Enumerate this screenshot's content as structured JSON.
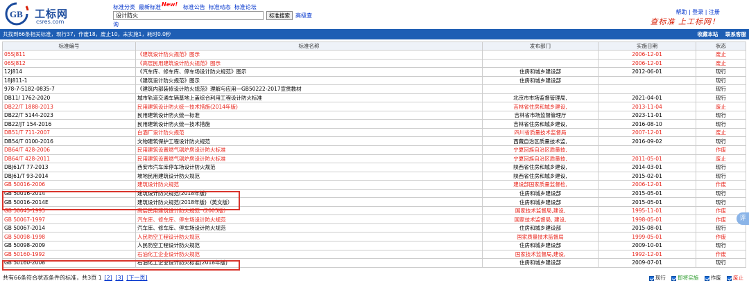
{
  "header": {
    "logo_title": "工标网",
    "logo_sub": "csres.com",
    "logo_mark": "GB",
    "nav": [
      "标准分类",
      "最新标准",
      "标准公告",
      "标准动态",
      "标准论坛"
    ],
    "nav_new_badge": "New!",
    "search_value": "设计防火",
    "search_button": "标准搜索",
    "advanced": "高级查",
    "advanced_tail": "询",
    "top_links": "帮助 | 登录 | 注册",
    "slogan": "查标准 上工标网！"
  },
  "infobar": {
    "summary": "共找到66条相关标准，现行37，作废18，废止10，未实施1，耗时0.0秒",
    "bookmark": "收藏本站",
    "contact": "联系客服"
  },
  "table": {
    "headers": [
      "标准编号",
      "标准名称",
      "发布部门",
      "实施日期",
      "状态"
    ],
    "rows": [
      {
        "code": "05SJ811",
        "name": "《建筑设计防火规范》图示",
        "dept": "",
        "date": "2006-12-01",
        "status": "废止",
        "red": true
      },
      {
        "code": "06SJ812",
        "name": "《高层民用建筑设计防火规范》图示",
        "dept": "",
        "date": "2006-12-01",
        "status": "废止",
        "red": true
      },
      {
        "code": "12J814",
        "name": "《汽车库、修车库、停车场设计防火规范》图示",
        "dept": "住房和城乡建设部",
        "date": "2012-06-01",
        "status": "现行",
        "red": false
      },
      {
        "code": "18J811-1",
        "name": "《建筑设计防火规范》图示",
        "dept": "住房和城乡建设部",
        "date": "",
        "status": "现行",
        "red": false
      },
      {
        "code": "978-7-5182-0835-7",
        "name": "《建筑内部装修设计防火规范》理解与应用—GB50222-2017宣贯教材",
        "dept": "",
        "date": "",
        "status": "现行",
        "red": false
      },
      {
        "code": "DB11/ 1762-2020",
        "name": "城市轨道交通车辆基地上盖综合利用工程设计防火标准",
        "dept": "北京市市场监督管理局,",
        "date": "2021-04-01",
        "status": "现行",
        "red": false
      },
      {
        "code": "DB22/T 1888-2013",
        "name": "民用建筑设计防火统一技术措施(2014年版)",
        "dept": "吉林省住房和城乡建设,",
        "date": "2013-11-04",
        "status": "废止",
        "red": true
      },
      {
        "code": "DB22/T 5144-2023",
        "name": "民用建筑设计防火统一标准",
        "dept": "吉林省市场监督管理厅",
        "date": "2023-11-01",
        "status": "现行",
        "red": false
      },
      {
        "code": "DB22/JT 154-2016",
        "name": "民用建筑设计防火统一技术措施",
        "dept": "吉林省住房和城乡建设,",
        "date": "2016-08-10",
        "status": "现行",
        "red": false
      },
      {
        "code": "DB51/T 711-2007",
        "name": "白酒厂设计防火规范",
        "dept": "四川省质量技术监督局",
        "date": "2007-12-01",
        "status": "废止",
        "red": true
      },
      {
        "code": "DB54/T 0100-2016",
        "name": "文物建筑保护工程设计防火规范",
        "dept": "西藏自治区质量技术监,",
        "date": "2016-09-02",
        "status": "现行",
        "red": false
      },
      {
        "code": "DB64/T 428-2006",
        "name": "民用建筑设置燃气锅炉房设计防火标准",
        "dept": "宁夏回族自治区质量技,",
        "date": "",
        "status": "作废",
        "red": true
      },
      {
        "code": "DB64/T 428-2011",
        "name": "民用建筑设置燃气锅炉房设计防火标准",
        "dept": "宁夏回族自治区质量技,",
        "date": "2011-05-01",
        "status": "废止",
        "red": true
      },
      {
        "code": "DBJ61/T 77-2013",
        "name": "西安市汽车库停车场设计防火规范",
        "dept": "陕西省住房和城乡建设,",
        "date": "2014-03-01",
        "status": "现行",
        "red": false
      },
      {
        "code": "DBJ61/T 93-2014",
        "name": "坡地民用建筑设计防火规范",
        "dept": "陕西省住房和城乡建设,",
        "date": "2015-02-01",
        "status": "现行",
        "red": false
      },
      {
        "code": "GB 50016-2006",
        "name": "建筑设计防火规范",
        "dept": "建设部国家质量监督检,",
        "date": "2006-12-01",
        "status": "作废",
        "red": true
      },
      {
        "code": "GB 50016-2014",
        "name": "建筑设计防火规范(2018年版)",
        "dept": "住房和城乡建设部",
        "date": "2015-05-01",
        "status": "现行",
        "red": false
      },
      {
        "code": "GB 50016-2014E",
        "name": "建筑设计防火规范(2018年版)（英文版）",
        "dept": "住房和城乡建设部",
        "date": "2015-05-01",
        "status": "现行",
        "red": false
      },
      {
        "code": "GB 50045-1995",
        "name": "高层民用建筑设计防火规范（2005版）",
        "dept": "国家技术监督局,建设,",
        "date": "1995-11-01",
        "status": "作废",
        "red": true
      },
      {
        "code": "GB 50067-1997",
        "name": "汽车库、修车库、停车场设计防火规范",
        "dept": "国家技术监督局, 建设,",
        "date": "1998-05-01",
        "status": "作废",
        "red": true
      },
      {
        "code": "GB 50067-2014",
        "name": "汽车库、修车库、停车场设计防火规范",
        "dept": "住房和城乡建设部",
        "date": "2015-08-01",
        "status": "现行",
        "red": false
      },
      {
        "code": "GB 50098-1998",
        "name": "人民防空工程设计防火规范",
        "dept": "国家质量技术监督局",
        "date": "1999-05-01",
        "status": "作废",
        "red": true
      },
      {
        "code": "GB 50098-2009",
        "name": "人民防空工程设计防火规范",
        "dept": "住房和城乡建设部",
        "date": "2009-10-01",
        "status": "现行",
        "red": false
      },
      {
        "code": "GB 50160-1992",
        "name": "石油化工企业设计防火规范",
        "dept": "国家技术监督局,建设,",
        "date": "1992-12-01",
        "status": "作废",
        "red": true
      },
      {
        "code": "GB 50160-2008",
        "name": "石油化工企业设计防火标准(2018年版)",
        "dept": "住房和城乡建设部",
        "date": "2009-07-01",
        "status": "现行",
        "red": false
      }
    ]
  },
  "footer": {
    "text": "共有66条符合状态条件的标准，共3页 1",
    "pages": [
      "[2]",
      "[3]",
      "[下一页]"
    ]
  },
  "legend": {
    "current": "现行",
    "upcoming": "即将实施",
    "obsolete": "作废",
    "abolished": "废止"
  },
  "float_button": "评"
}
